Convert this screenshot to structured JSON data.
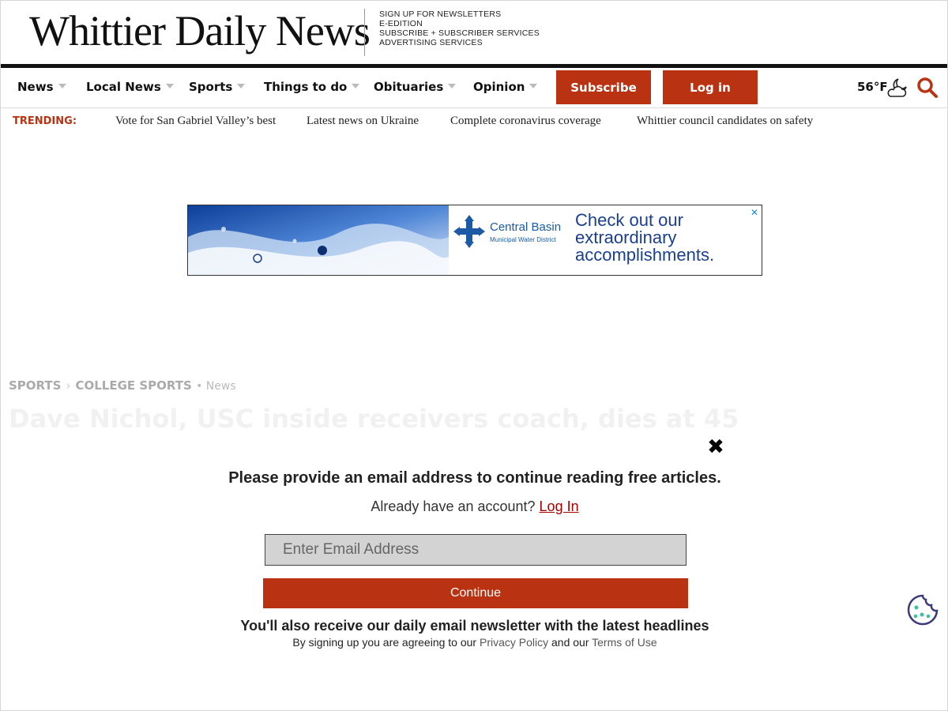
{
  "masthead": {
    "logo": "Whittier Daily News",
    "links": [
      "SIGN UP FOR NEWSLETTERS",
      "E-EDITION",
      "SUBSCRIBE + SUBSCRIBER SERVICES",
      "ADVERTISING SERVICES"
    ]
  },
  "nav": {
    "items": [
      "News",
      "Local News",
      "Sports",
      "Things to do",
      "Obituaries",
      "Opinion"
    ],
    "subscribe_label": "Subscribe",
    "login_label": "Log in",
    "weather": "56°F",
    "weather_icon": "partly-cloudy-night-icon",
    "search_icon": "search-icon"
  },
  "trending": {
    "label": "TRENDING:",
    "links": [
      "Vote for San Gabriel Valley’s best",
      "Latest news on Ukraine",
      "Complete coronavirus coverage",
      "Whittier council candidates on safety"
    ]
  },
  "ad": {
    "brand": "Central Basin",
    "brand_sub": "Municipal Water District",
    "headline": "Check out our extraordinary accomplishments.",
    "close": "✕"
  },
  "article": {
    "crumbs": [
      "SPORTS",
      "COLLEGE SPORTS"
    ],
    "crumb_sub": "• News",
    "title": "Dave Nichol, USC inside receivers coach, dies at 45"
  },
  "modal": {
    "close": "✖",
    "heading": "Please provide an email address to continue reading free articles.",
    "sub_text": "Already have an account? ",
    "sub_link": "Log In",
    "email_placeholder": "Enter Email Address",
    "continue_label": "Continue",
    "note": "You'll also receive our daily email newsletter with the latest headlines",
    "fine_prefix": "By signing up you are agreeing to our ",
    "privacy_link": "Privacy Policy",
    "fine_mid": " and our ",
    "terms_link": "Terms of Use"
  },
  "colors": {
    "accent": "#b93313",
    "text": "#111111"
  }
}
